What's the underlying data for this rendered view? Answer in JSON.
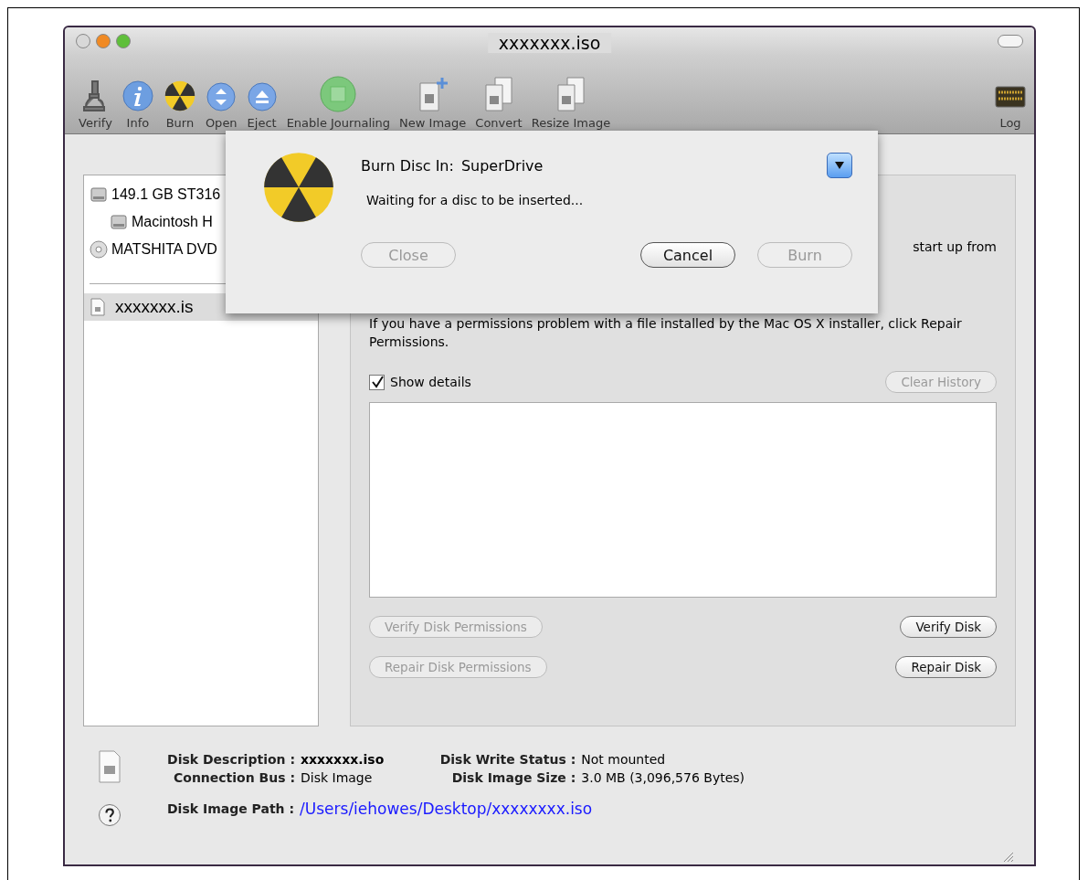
{
  "window": {
    "title": "xxxxxxx.iso"
  },
  "toolbar": [
    {
      "label": "Verify",
      "kind": "microscope"
    },
    {
      "label": "Info",
      "kind": "info"
    },
    {
      "label": "Burn",
      "kind": "burn"
    },
    {
      "label": "Open",
      "kind": "open"
    },
    {
      "label": "Eject",
      "kind": "eject"
    },
    {
      "label": "Enable Journaling",
      "kind": "journal"
    },
    {
      "label": "New Image",
      "kind": "newimage"
    },
    {
      "label": "Convert",
      "kind": "convert"
    },
    {
      "label": "Resize Image",
      "kind": "resize"
    },
    {
      "label": "Log",
      "kind": "log"
    }
  ],
  "sidebar": {
    "groups": [
      [
        {
          "label": "149.1 GB ST316",
          "kind": "disk",
          "selected": false,
          "children": [
            {
              "label": "Macintosh H",
              "kind": "disk",
              "selected": false
            }
          ]
        },
        {
          "label": "MATSHITA DVD",
          "kind": "optical",
          "selected": false
        }
      ],
      [
        {
          "label": "xxxxxxx.is",
          "kind": "image",
          "selected": true
        }
      ]
    ]
  },
  "panel": {
    "fragment": "start up from",
    "paragraph": "If you have a permissions problem with a file installed by the Mac OS X installer, click Repair Permissions.",
    "show_details": {
      "label": "Show details",
      "checked": true
    },
    "clear_history": {
      "label": "Clear History",
      "disabled": true
    },
    "buttons": [
      {
        "label": "Verify Disk Permissions",
        "disabled": true
      },
      {
        "label": "Verify Disk",
        "disabled": false
      },
      {
        "label": "Repair Disk Permissions",
        "disabled": true
      },
      {
        "label": "Repair Disk",
        "disabled": false
      }
    ]
  },
  "sheet": {
    "label": "Burn Disc In:",
    "drive": "SuperDrive",
    "status": "Waiting for a disc to be inserted...",
    "buttons": [
      {
        "label": "Close",
        "disabled": true,
        "default": false
      },
      {
        "label": "Cancel",
        "disabled": false,
        "default": false
      },
      {
        "label": "Burn",
        "disabled": true,
        "default": false
      }
    ]
  },
  "info": {
    "left": [
      {
        "label": "Disk Description :",
        "value": "xxxxxxx.iso",
        "bold": true
      },
      {
        "label": "Connection Bus :",
        "value": "Disk Image",
        "bold": false
      }
    ],
    "right": [
      {
        "label": "Disk Write Status :",
        "value": "Not mounted"
      },
      {
        "label": "Disk Image Size :",
        "value": "3.0 MB (3,096,576 Bytes)"
      }
    ],
    "path": {
      "label": "Disk Image Path :",
      "value": "/Users/iehowes/Desktop/xxxxxxxx.iso"
    }
  }
}
